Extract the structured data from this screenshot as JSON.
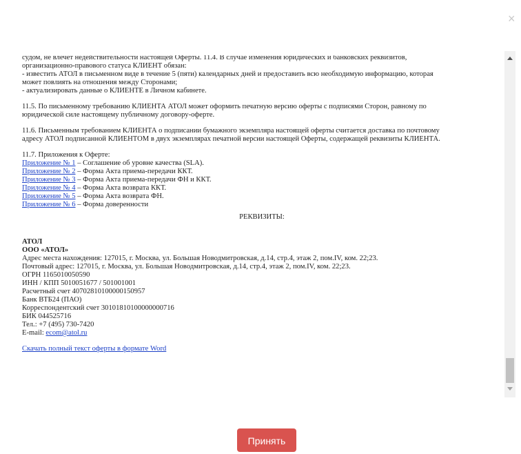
{
  "close_glyph": "×",
  "offer": {
    "p1_l1": "судом, не влечет недействительности настоящей Оферты. 11.4. В случае изменения юридических и банковских реквизитов,",
    "p1_l2": "организационно-правового статуса КЛИЕНТ обязан:",
    "p1_l3": "- известить АТОЛ в письменном виде в течение 5 (пяти) календарных дней и предоставить всю необходимую информацию, которая",
    "p1_l4": "может повлиять на отношения между Сторонами;",
    "p1_l5": "- актуализировать данные о КЛИЕНТЕ в Личном кабинете.",
    "p2_l1": "11.5. По письменному требованию КЛИЕНТА АТОЛ может оформить печатную версию оферты с подписями Сторон, равному по",
    "p2_l2": "юридической силе настоящему публичному договору-оферте.",
    "p3_l1": "11.6. Письменным требованием КЛИЕНТА о подписании бумажного экземпляра настоящей оферты считается доставка по почтовому",
    "p3_l2": "адресу АТОЛ подписанной КЛИЕНТОМ в двух экземплярах печатной версии настоящей Оферты, содержащей реквизиты КЛИЕНТА.",
    "appendix_title": "11.7. Приложения к Оферте:",
    "appendices": [
      {
        "link": "Приложение № 1",
        "text": " – Соглашение об уровне качества (SLA)."
      },
      {
        "link": "Приложение № 2",
        "text": " – Форма Акта приема-передачи ККТ."
      },
      {
        "link": "Приложение № 3",
        "text": " – Форма Акта приема-передачи ФН и ККТ."
      },
      {
        "link": "Приложение № 4",
        "text": " – Форма Акта возврата ККТ."
      },
      {
        "link": "Приложение № 5",
        "text": " – Форма Акта возврата ФН."
      },
      {
        "link": "Приложение № 6",
        "text": " – Форма доверенности"
      }
    ],
    "requisites_title": "РЕКВИЗИТЫ:",
    "company_short": "АТОЛ",
    "company_full": "ООО «АТОЛ»",
    "legal_address": "Адрес места нахождения: 127015, г. Москва, ул. Большая Новодмитровская, д.14, стр.4, этаж 2, пом.IV, ком. 22;23.",
    "postal_address": "Почтовый адрес: 127015, г. Москва, ул. Большая Новодмитровская, д.14, стр.4, этаж 2, пом.IV, ком. 22;23.",
    "ogrn": "ОГРН 1165010050590",
    "inn_kpp": "ИНН / КПП 5010051677 / 501001001",
    "account": "Расчетный счет 40702810100000150957",
    "bank": "Банк ВТБ24 (ПАО)",
    "corr_account": "Корреспондентский счет 30101810100000000716",
    "bik": "БИК 044525716",
    "phone": "Тел.: +7 (495) 730-7420",
    "email_label": "E-mail: ",
    "email": "ecom@atol.ru",
    "download_link": "Скачать полный текст оферты в формате Word"
  },
  "accept_button": "Принять",
  "colors": {
    "accent": "#d9534f",
    "link": "#1a3fc7"
  }
}
